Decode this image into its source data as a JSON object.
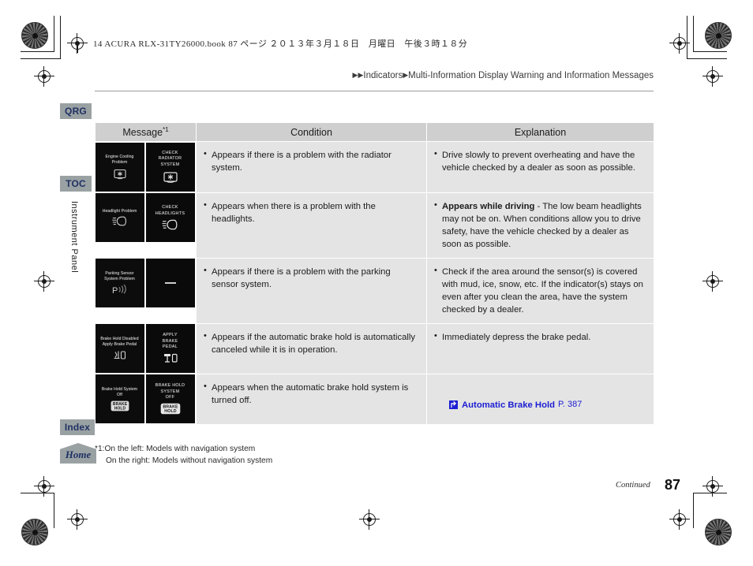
{
  "print_marks": {
    "jp_header": "14 ACURA RLX-31TY26000.book  87 ページ   ２０１３年３月１８日　月曜日　午後３時１８分"
  },
  "breadcrumb": {
    "arrow": "▶",
    "item1": "Indicators",
    "item2": "Multi-Information Display Warning and Information Messages"
  },
  "sidebar": {
    "tabs": [
      {
        "id": "qrg",
        "label": "QRG"
      },
      {
        "id": "toc",
        "label": "TOC"
      },
      {
        "id": "index",
        "label": "Index"
      },
      {
        "id": "home",
        "label": "Home"
      }
    ],
    "section_label": "Instrument Panel"
  },
  "table": {
    "headers": {
      "message": "Message",
      "message_note": "*1",
      "condition": "Condition",
      "explanation": "Explanation"
    },
    "rows": [
      {
        "tile_left_text": "Engine Cooling\nProblem",
        "tile_left_icon": "engine-coolant-temp-icon",
        "tile_right_text": "CHECK\nRADIATOR\nSYSTEM",
        "tile_right_icon": "engine-coolant-temp-icon",
        "condition": "Appears if there is a problem with the radiator system.",
        "explanation": "Drive slowly to prevent overheating and have the vehicle checked by a dealer as soon as possible."
      },
      {
        "tile_left_text": "Headlight Problem",
        "tile_left_icon": "low-beam-headlight-icon",
        "tile_right_text": "CHECK\nHEADLIGHTS",
        "tile_right_icon": "low-beam-headlight-icon",
        "condition": "Appears when there is a problem with the headlights.",
        "explanation_bold": "Appears while driving",
        "explanation": " - The low beam headlights may not be on. When conditions allow you to drive safety, have the vehicle checked by a dealer as soon as possible."
      },
      {
        "tile_left_text": "Parking Sensor\nSystem Problem",
        "tile_left_icon": "parking-sensor-icon",
        "tile_right_text": "—",
        "tile_right_icon": "dash-icon",
        "condition": "Appears if there is a problem with the parking sensor system.",
        "explanation": "Check if the area around the sensor(s) is covered with mud, ice, snow, etc. If the indicator(s) stays on even after you clean the area, have the system checked by a dealer."
      },
      {
        "tile_left_text": "Brake Hold Disabled\nApply Brake Pedal",
        "tile_left_icon": "brake-pedal-icon",
        "tile_right_text": "APPLY\nBRAKE\nPEDAL",
        "tile_right_icon": "brake-pedal-icon",
        "condition": "Appears if the automatic brake hold is automatically canceled while it is in operation.",
        "explanation": "Immediately depress the brake pedal."
      },
      {
        "tile_left_text": "Brake Hold System\nOff",
        "tile_left_icon": "brake-hold-icon",
        "tile_right_text": "BRAKE HOLD\nSYSTEM\nOFF",
        "tile_right_icon": "brake-hold-icon",
        "condition": "Appears when the automatic brake hold system is turned off.",
        "link_text": "Automatic Brake Hold",
        "link_page": "P. 387",
        "link_icon": "jump-arrow-icon"
      }
    ]
  },
  "footnote": {
    "line1": "*1:On the left: Models with navigation system",
    "line2": "On the right: Models without navigation system"
  },
  "footer": {
    "continued": "Continued",
    "page_number": "87"
  },
  "colors": {
    "tab_bg": "#9aa1a3",
    "tab_text": "#1f3164",
    "header_bg": "#cfcfcf",
    "cell_bg": "#e4e4e4",
    "link_blue": "#1b1ed2"
  }
}
